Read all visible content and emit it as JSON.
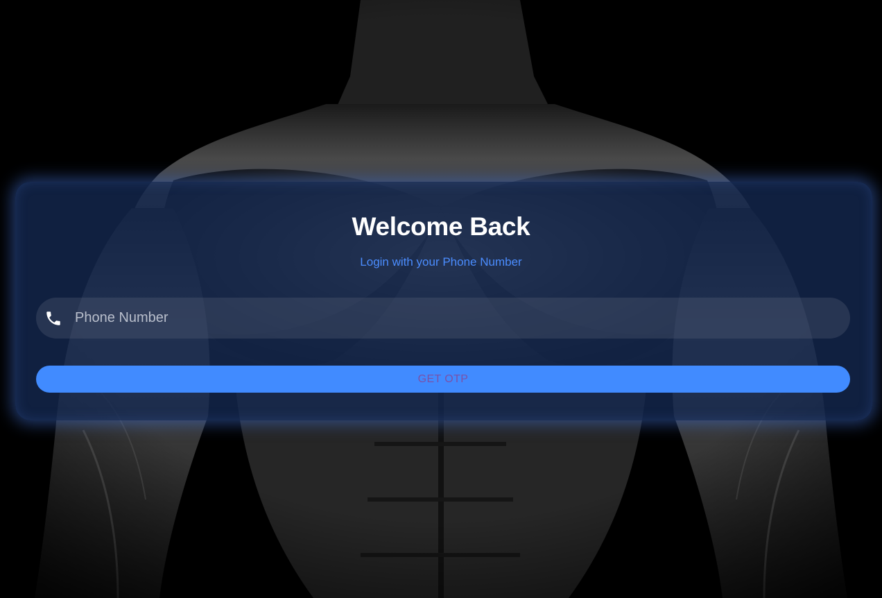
{
  "login": {
    "title": "Welcome Back",
    "subtitle": "Login with your Phone Number",
    "phone_placeholder": "Phone Number",
    "phone_value": "",
    "otp_button_label": "GET OTP"
  },
  "icons": {
    "phone": "phone-icon"
  },
  "colors": {
    "background": "#000000",
    "card": "#152952",
    "accent": "#418bff",
    "subtitle": "#4b8dff",
    "button_text": "#7a51a8"
  },
  "background_image": "muscular-torso"
}
